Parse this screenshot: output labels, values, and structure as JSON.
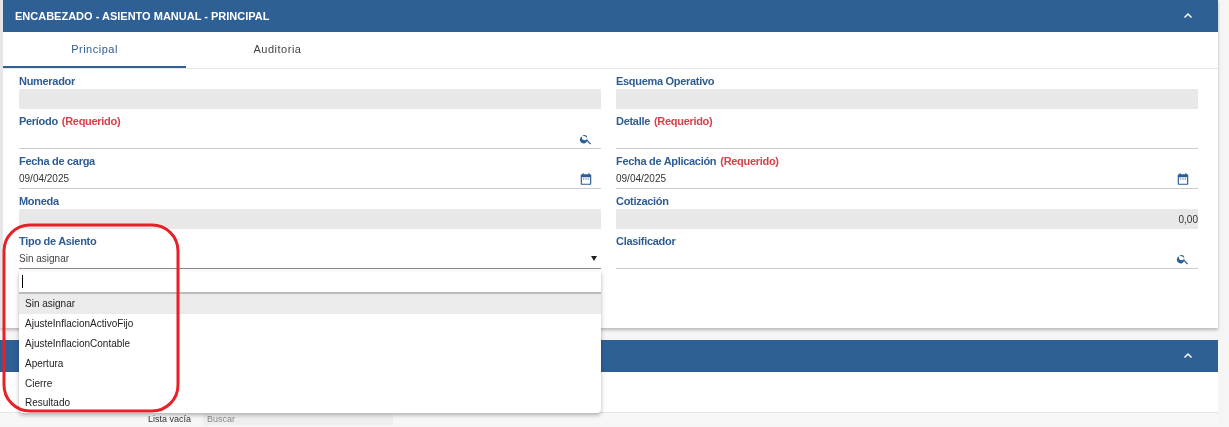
{
  "header": {
    "title": "ENCABEZADO - ASIENTO MANUAL - PRINCIPAL",
    "expanded": true
  },
  "tabs": [
    {
      "label": "Principal",
      "selected": true
    },
    {
      "label": "Auditoria",
      "selected": false
    }
  ],
  "left_fields": [
    {
      "label": "Numerador",
      "kind": "readonly"
    },
    {
      "label": "Período",
      "required": "(Requerido)",
      "kind": "lookup"
    },
    {
      "label": "Fecha de carga",
      "kind": "date",
      "value": "09/04/2025"
    },
    {
      "label": "Moneda",
      "kind": "readonly"
    },
    {
      "label": "Tipo de Asiento",
      "kind": "select",
      "value": "Sin asignar"
    }
  ],
  "right_fields": [
    {
      "label": "Esquema Operativo",
      "kind": "readonly"
    },
    {
      "label": "Detalle",
      "required": "(Requerido)",
      "kind": "text"
    },
    {
      "label": "Fecha de Aplicación",
      "required": "(Requerido)",
      "kind": "date",
      "value": "09/04/2025"
    },
    {
      "label": "Cotización",
      "kind": "readonly",
      "value": "0,00"
    },
    {
      "label": "Clasificador",
      "kind": "lookup"
    }
  ],
  "dropdown": {
    "options": [
      {
        "label": "Sin asignar",
        "selected": true
      },
      {
        "label": "AjusteInflacionActivoFijo",
        "selected": false
      },
      {
        "label": "AjusteInflacionContable",
        "selected": false
      },
      {
        "label": "Apertura",
        "selected": false
      },
      {
        "label": "Cierre",
        "selected": false
      },
      {
        "label": "Resultado",
        "selected": false
      }
    ]
  },
  "second_panel": {
    "expanded": true
  },
  "toolbar": {
    "status": "Lista vacía",
    "search_placeholder": "Buscar"
  }
}
